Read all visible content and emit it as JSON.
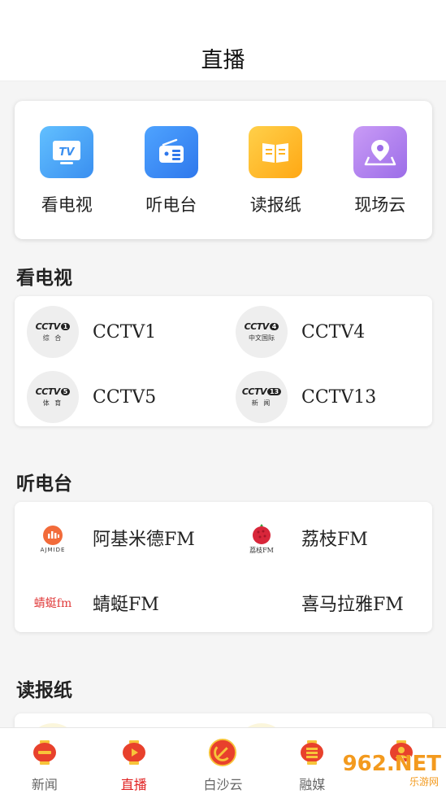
{
  "header": {
    "title": "直播"
  },
  "quick_nav": [
    {
      "label": "看电视",
      "icon": "tv-icon",
      "color": "#4aa8f8"
    },
    {
      "label": "听电台",
      "icon": "radio-icon",
      "color": "#3c8df0"
    },
    {
      "label": "读报纸",
      "icon": "newspaper-icon",
      "color": "#ffb21e"
    },
    {
      "label": "现场云",
      "icon": "location-icon",
      "color": "#b07ef0"
    }
  ],
  "tv_section": {
    "title": "看电视",
    "channels": [
      {
        "label": "CCTV1",
        "logo_num": "1",
        "logo_sub": "综 合"
      },
      {
        "label": "CCTV4",
        "logo_num": "4",
        "logo_sub": "中文国际"
      },
      {
        "label": "CCTV5",
        "logo_num": "5",
        "logo_sub": "体 育"
      },
      {
        "label": "CCTV13",
        "logo_num": "13",
        "logo_sub": "新 闻"
      }
    ]
  },
  "radio_section": {
    "title": "听电台",
    "stations": [
      {
        "label": "阿基米德FM",
        "logo_text": "AJMIDE"
      },
      {
        "label": "荔枝FM",
        "logo_text": "荔枝FM"
      },
      {
        "label": "蜻蜓FM",
        "logo_text": "蜻蜓fm"
      },
      {
        "label": "喜马拉雅FM",
        "logo_text": ""
      }
    ]
  },
  "newspaper_section": {
    "title": "读报纸"
  },
  "tabbar": [
    {
      "label": "新闻",
      "active": false
    },
    {
      "label": "直播",
      "active": true
    },
    {
      "label": "白沙云",
      "active": false
    },
    {
      "label": "融媒",
      "active": false
    },
    {
      "label": "",
      "active": false
    }
  ],
  "watermark": {
    "big": "962.NET",
    "small": "乐游网"
  },
  "colors": {
    "accent": "#e02020",
    "lantern": "#e8412c",
    "lantern_gold": "#f7c43a"
  }
}
